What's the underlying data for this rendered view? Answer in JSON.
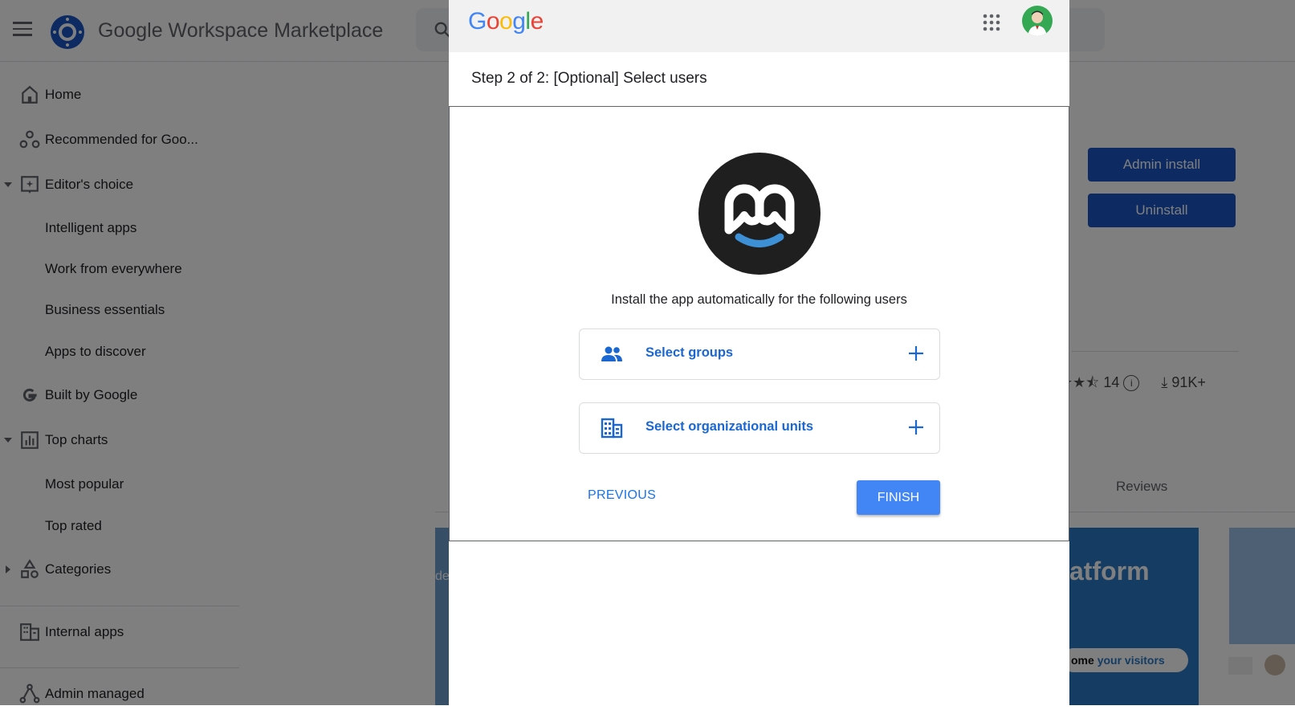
{
  "marketplace": {
    "title": "Google Workspace Marketplace",
    "nav": [
      {
        "label": "Home",
        "icon": "home-icon"
      },
      {
        "label": "Recommended for Goo...",
        "icon": "recommended-icon"
      },
      {
        "label": "Editor's choice",
        "icon": "editors-choice-icon"
      },
      {
        "label": "Intelligent apps"
      },
      {
        "label": "Work from everywhere"
      },
      {
        "label": "Business essentials"
      },
      {
        "label": "Apps to discover"
      },
      {
        "label": "Built by Google",
        "icon": "google-g-icon"
      },
      {
        "label": "Top charts",
        "icon": "top-charts-icon"
      },
      {
        "label": "Most popular"
      },
      {
        "label": "Top rated"
      },
      {
        "label": "Categories",
        "icon": "categories-icon"
      },
      {
        "label": "Internal apps",
        "icon": "building-icon"
      },
      {
        "label": "Admin managed",
        "icon": "admin-managed-icon"
      }
    ],
    "admin_install_label": "Admin install",
    "uninstall_label": "Uninstall",
    "rating_count": "14",
    "downloads": "91K+",
    "reviews_tab": "Reviews",
    "banner_text": "atform",
    "banner_pill_prefix": "ome",
    "banner_pill_highlight": "your visitors",
    "banner_left_text": "de"
  },
  "dialog": {
    "logo_text": "Google",
    "step_title": "Step 2 of 2: [Optional] Select users",
    "install_text": "Install the app automatically for the following users",
    "select_groups": "Select groups",
    "select_org_units": "Select organizational units",
    "previous_label": "PREVIOUS",
    "finish_label": "FINISH"
  },
  "colors": {
    "primary_blue": "#1a56c4",
    "finish_blue": "#4285f4",
    "link_blue": "#1a73e8"
  }
}
